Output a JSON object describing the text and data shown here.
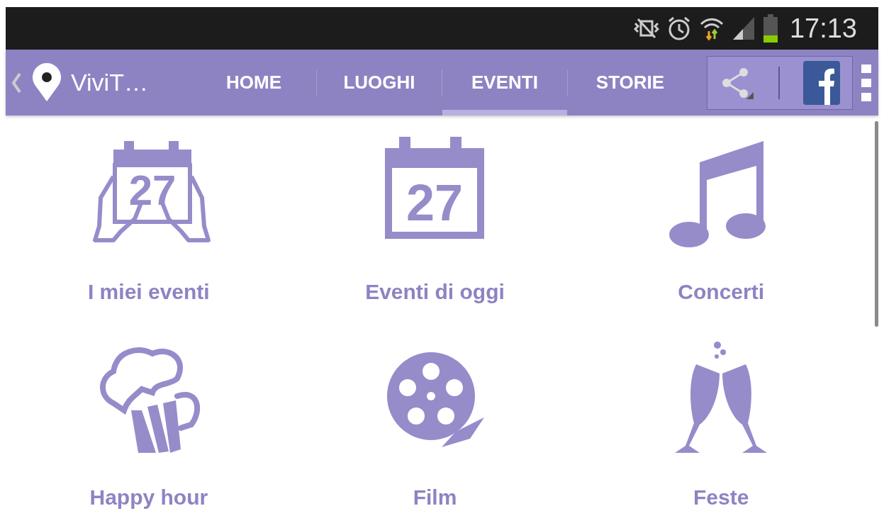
{
  "status_bar": {
    "time": "17:13"
  },
  "action_bar": {
    "title": "ViviT…",
    "tabs": [
      {
        "label": "HOME",
        "selected": false
      },
      {
        "label": "LUOGHI",
        "selected": false
      },
      {
        "label": "EVENTI",
        "selected": true
      },
      {
        "label": "STORIE",
        "selected": false
      }
    ]
  },
  "categories": [
    {
      "kind": "hands-calendar",
      "label": "I miei eventi",
      "calendar_day": "27"
    },
    {
      "kind": "calendar",
      "label": "Eventi di oggi",
      "calendar_day": "27"
    },
    {
      "kind": "note",
      "label": "Concerti"
    },
    {
      "kind": "beer",
      "label": "Happy hour"
    },
    {
      "kind": "film",
      "label": "Film"
    },
    {
      "kind": "glasses",
      "label": "Feste"
    }
  ]
}
